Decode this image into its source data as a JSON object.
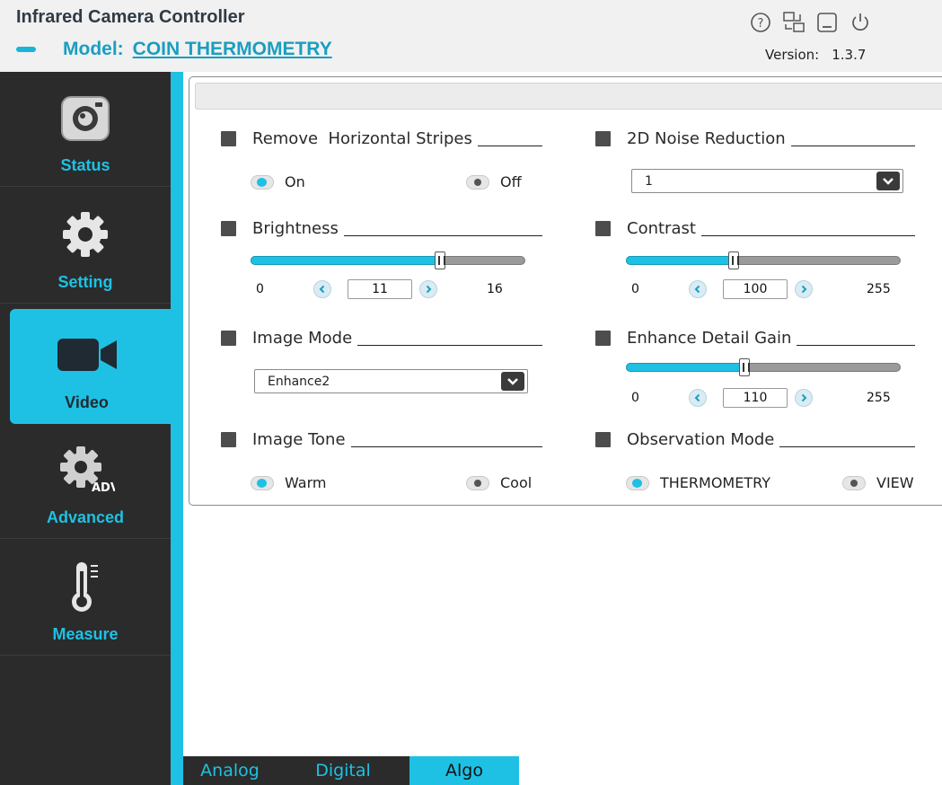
{
  "app": {
    "title": "Infrared Camera Controller",
    "model_label": "Model:",
    "model_value": "COIN THERMOMETRY",
    "version_label": "Version:",
    "version_value": "1.3.7",
    "window_icons": [
      "help-icon",
      "network-icon",
      "minimize-icon",
      "power-icon"
    ]
  },
  "sidebar": {
    "items": [
      {
        "label": "Status",
        "icon": "camera-icon",
        "active": false
      },
      {
        "label": "Setting",
        "icon": "gear-icon",
        "active": false
      },
      {
        "label": "Video",
        "icon": "video-camera-icon",
        "active": true
      },
      {
        "label": "Advanced",
        "icon": "adv-gear-icon",
        "icon_text": "ADV",
        "active": false
      },
      {
        "label": "Measure",
        "icon": "thermometer-icon",
        "active": false
      }
    ]
  },
  "panel": {
    "remove_stripes": {
      "label": "Remove  Horizontal Stripes",
      "options": [
        "On",
        "Off"
      ],
      "selected": "On"
    },
    "noise_reduction": {
      "label": "2D Noise Reduction",
      "value": "1"
    },
    "brightness": {
      "label": "Brightness",
      "min": "0",
      "max": "16",
      "value": "11",
      "fraction": 0.688
    },
    "contrast": {
      "label": "Contrast",
      "min": "0",
      "max": "255",
      "value": "100",
      "fraction": 0.392
    },
    "image_mode": {
      "label": "Image Mode",
      "value": "Enhance2"
    },
    "detail_gain": {
      "label": "Enhance Detail Gain",
      "min": "0",
      "max": "255",
      "value": "110",
      "fraction": 0.431
    },
    "image_tone": {
      "label": "Image Tone",
      "options": [
        "Warm",
        "Cool"
      ],
      "selected": "Warm"
    },
    "observation_mode": {
      "label": "Observation Mode",
      "options": [
        "THERMOMETRY",
        "VIEW"
      ],
      "selected": "THERMOMETRY"
    }
  },
  "tabs": [
    {
      "label": "Analog",
      "active": false
    },
    {
      "label": "Digital",
      "active": false
    },
    {
      "label": "Algo",
      "active": true
    }
  ],
  "colors": {
    "accent": "#1ec1e3",
    "sidebar_bg": "#2b2b2b",
    "title_blue": "#1a9ec0"
  }
}
